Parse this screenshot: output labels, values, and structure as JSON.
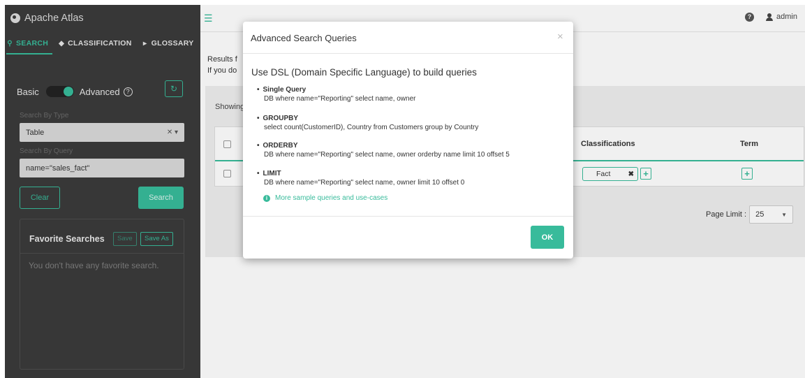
{
  "app": {
    "title": "Apache Atlas"
  },
  "tabs": [
    {
      "label": "SEARCH",
      "icon": "search-icon"
    },
    {
      "label": "CLASSIFICATION",
      "icon": "tag-icon"
    },
    {
      "label": "GLOSSARY",
      "icon": "folder-icon"
    }
  ],
  "search": {
    "basic_label": "Basic",
    "advanced_label": "Advanced",
    "help_glyph": "?",
    "by_type_label": "Search By Type",
    "type_value": "Table",
    "by_query_label": "Search By Query",
    "query_value": "name=\"sales_fact\"",
    "clear_label": "Clear",
    "search_label": "Search"
  },
  "favorites": {
    "title": "Favorite Searches",
    "save_label": "Save",
    "save_as_label": "Save As",
    "empty_text": "You don't have any favorite search."
  },
  "header": {
    "help_glyph": "?",
    "user": "admin"
  },
  "results": {
    "line1": "Results f",
    "line2": "If you do",
    "showing": "Showing",
    "columns": {
      "classifications": "Classifications",
      "term": "Term"
    },
    "row": {
      "classification_chip": "Fact",
      "chip_remove": "✖",
      "add_glyph": "+"
    },
    "page_limit_label": "Page Limit :",
    "page_limit_value": "25"
  },
  "modal": {
    "title": "Advanced Search Queries",
    "close": "×",
    "heading": "Use DSL (Domain Specific Language) to build queries",
    "items": [
      {
        "title": "Single Query",
        "example": "DB where name=\"Reporting\" select name, owner"
      },
      {
        "title": "GROUPBY",
        "example": "select count(CustomerID), Country from Customers group by Country"
      },
      {
        "title": "ORDERBY",
        "example": "DB where name=\"Reporting\" select name, owner orderby name limit 10 offset 5"
      },
      {
        "title": "LIMIT",
        "example": "DB where name=\"Reporting\" select name, owner limit 10 offset 0"
      }
    ],
    "more_link": "More sample queries and use-cases",
    "ok_label": "OK"
  },
  "colors": {
    "accent": "#38bb9b",
    "sidebar_bg": "#3b3b3b"
  }
}
